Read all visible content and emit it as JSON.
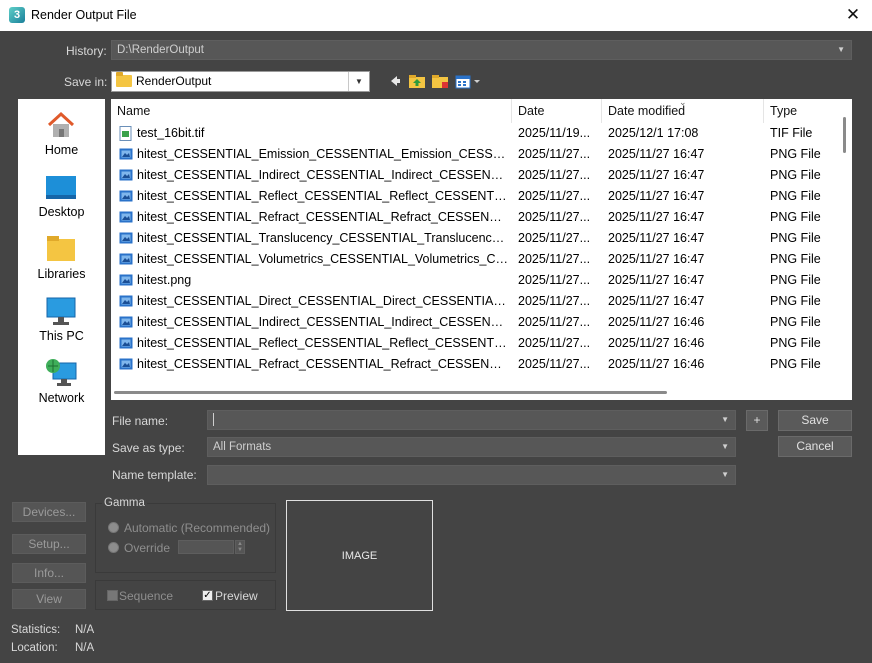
{
  "window": {
    "title": "Render Output File",
    "app_icon": "3",
    "close_glyph": "✕"
  },
  "history": {
    "label": "History:",
    "value": "D:\\RenderOutput"
  },
  "save_in": {
    "label": "Save in:",
    "value": "RenderOutput"
  },
  "places": [
    {
      "label": "Home",
      "icon": "home-icon"
    },
    {
      "label": "Desktop",
      "icon": "desktop-icon"
    },
    {
      "label": "Libraries",
      "icon": "libraries-icon"
    },
    {
      "label": "This PC",
      "icon": "this-pc-icon"
    },
    {
      "label": "Network",
      "icon": "network-icon"
    }
  ],
  "columns": {
    "name": "Name",
    "date": "Date",
    "modified": "Date modified",
    "type": "Type"
  },
  "files": [
    {
      "name": "test_16bit.tif",
      "date": "2025/11/19...",
      "modified": "2025/12/1 17:08",
      "type": "TIF File",
      "kind": "tif"
    },
    {
      "name": "hitest_CESSENTIAL_Emission_CESSENTIAL_Emission_CESSENTI...",
      "date": "2025/11/27...",
      "modified": "2025/11/27 16:47",
      "type": "PNG File",
      "kind": "png"
    },
    {
      "name": "hitest_CESSENTIAL_Indirect_CESSENTIAL_Indirect_CESSENTIAL_...",
      "date": "2025/11/27...",
      "modified": "2025/11/27 16:47",
      "type": "PNG File",
      "kind": "png"
    },
    {
      "name": "hitest_CESSENTIAL_Reflect_CESSENTIAL_Reflect_CESSENTIAL_R...",
      "date": "2025/11/27...",
      "modified": "2025/11/27 16:47",
      "type": "PNG File",
      "kind": "png"
    },
    {
      "name": "hitest_CESSENTIAL_Refract_CESSENTIAL_Refract_CESSENTIAL_...",
      "date": "2025/11/27...",
      "modified": "2025/11/27 16:47",
      "type": "PNG File",
      "kind": "png"
    },
    {
      "name": "hitest_CESSENTIAL_Translucency_CESSENTIAL_Translucency_CE...",
      "date": "2025/11/27...",
      "modified": "2025/11/27 16:47",
      "type": "PNG File",
      "kind": "png"
    },
    {
      "name": "hitest_CESSENTIAL_Volumetrics_CESSENTIAL_Volumetrics_CES...",
      "date": "2025/11/27...",
      "modified": "2025/11/27 16:47",
      "type": "PNG File",
      "kind": "png"
    },
    {
      "name": "hitest.png",
      "date": "2025/11/27...",
      "modified": "2025/11/27 16:47",
      "type": "PNG File",
      "kind": "png"
    },
    {
      "name": "hitest_CESSENTIAL_Direct_CESSENTIAL_Direct_CESSENTIAL_Dir...",
      "date": "2025/11/27...",
      "modified": "2025/11/27 16:47",
      "type": "PNG File",
      "kind": "png"
    },
    {
      "name": "hitest_CESSENTIAL_Indirect_CESSENTIAL_Indirect_CESSENTIAL_...",
      "date": "2025/11/27...",
      "modified": "2025/11/27 16:46",
      "type": "PNG File",
      "kind": "png"
    },
    {
      "name": "hitest_CESSENTIAL_Reflect_CESSENTIAL_Reflect_CESSENTIAL_R...",
      "date": "2025/11/27...",
      "modified": "2025/11/27 16:46",
      "type": "PNG File",
      "kind": "png"
    },
    {
      "name": "hitest_CESSENTIAL_Refract_CESSENTIAL_Refract_CESSENTIAL_...",
      "date": "2025/11/27...",
      "modified": "2025/11/27 16:46",
      "type": "PNG File",
      "kind": "png"
    }
  ],
  "file_name": {
    "label": "File name:",
    "value": ""
  },
  "save_as_type": {
    "label": "Save as type:",
    "value": "All Formats"
  },
  "name_template": {
    "label": "Name template:",
    "value": ""
  },
  "buttons": {
    "plus": "+",
    "save": "Save",
    "cancel": "Cancel",
    "devices": "Devices...",
    "setup": "Setup...",
    "info": "Info...",
    "view": "View"
  },
  "gamma": {
    "title": "Gamma",
    "automatic": "Automatic (Recommended)",
    "override": "Override"
  },
  "sequence": "Sequence",
  "preview": "Preview",
  "image_label": "IMAGE",
  "statistics": {
    "label": "Statistics:",
    "value": "N/A"
  },
  "location": {
    "label": "Location:",
    "value": "N/A"
  },
  "colors": {
    "accent_blue": "#2a72c9",
    "folder_yellow": "#f4c542",
    "dialog_bg": "#444444"
  }
}
